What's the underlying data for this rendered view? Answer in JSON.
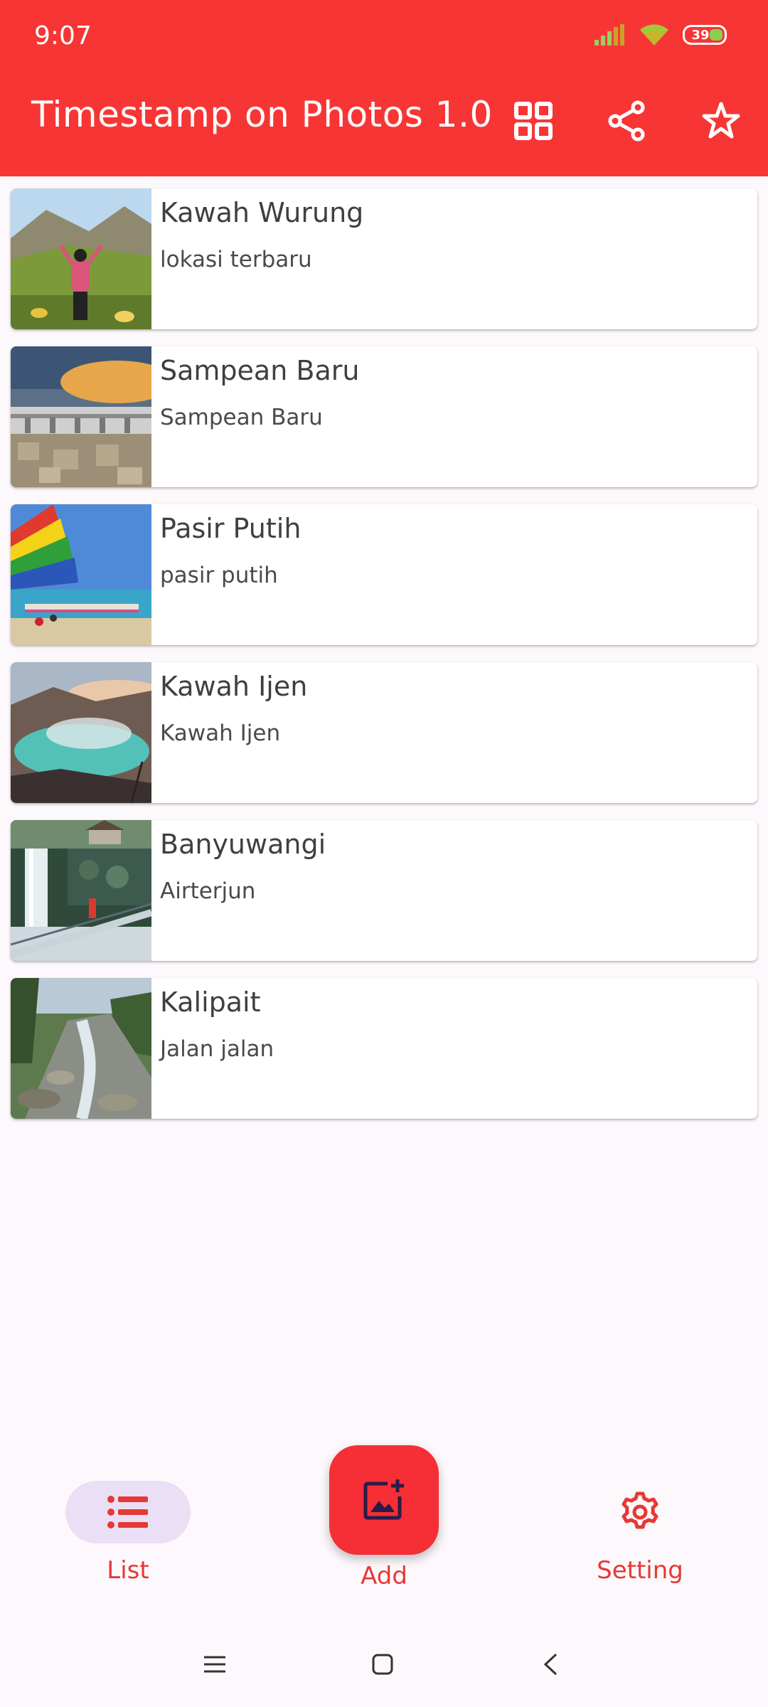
{
  "status_bar": {
    "time": "9:07",
    "battery_level": "39"
  },
  "app_bar": {
    "title": "Timestamp on Photos 1.0",
    "actions": [
      {
        "name": "grid-view",
        "icon": "grid-icon"
      },
      {
        "name": "share",
        "icon": "share-icon"
      },
      {
        "name": "rate",
        "icon": "star-icon"
      }
    ]
  },
  "items": [
    {
      "title": "Kawah Wurung",
      "subtitle": "lokasi terbaru",
      "thumb": "mountain meadow with person"
    },
    {
      "title": "Sampean Baru",
      "subtitle": "Sampean Baru",
      "thumb": "dam at sunset"
    },
    {
      "title": "Pasir Putih",
      "subtitle": "pasir putih",
      "thumb": "colorful sailboat on beach"
    },
    {
      "title": "Kawah Ijen",
      "subtitle": "Kawah Ijen",
      "thumb": "turquoise crater lake"
    },
    {
      "title": "Banyuwangi",
      "subtitle": "Airterjun",
      "thumb": "waterfall with bridge"
    },
    {
      "title": "Kalipait",
      "subtitle": "Jalan jalan",
      "thumb": "rocky river in forest"
    }
  ],
  "bottom_nav": {
    "list_label": "List",
    "add_label": "Add",
    "setting_label": "Setting"
  },
  "colors": {
    "primary": "#f73535",
    "nav_label": "#e53935",
    "nav_pill": "#ebdff5",
    "fab_icon": "#2b1a4a"
  }
}
